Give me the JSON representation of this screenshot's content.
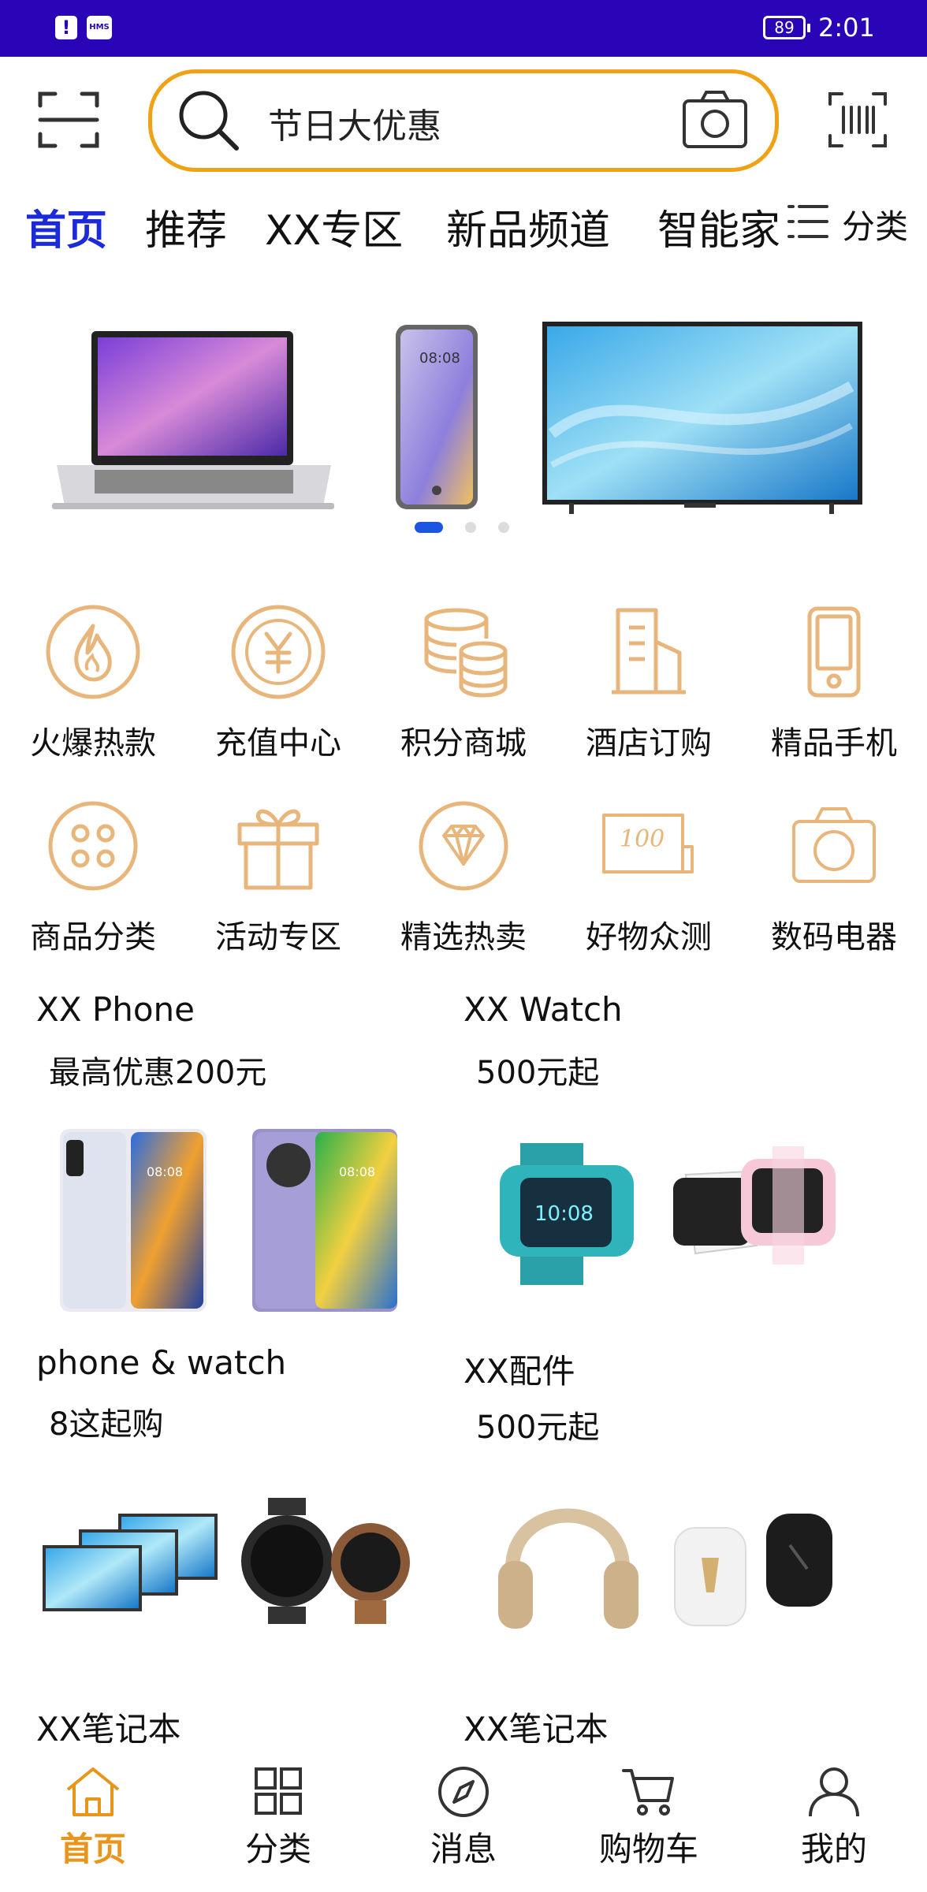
{
  "status_bar": {
    "battery": "89",
    "time": "2:01",
    "hms_label": "HMS"
  },
  "search": {
    "value": "节日大优惠"
  },
  "tabs": [
    {
      "label": "首页"
    },
    {
      "label": "推荐"
    },
    {
      "label": "XX专区"
    },
    {
      "label": "新品频道"
    },
    {
      "label": "智能家"
    }
  ],
  "category_button": {
    "label": "分类"
  },
  "banner": {
    "carousel_count": 3,
    "active_index": 0
  },
  "grid": [
    {
      "label": "火爆热款",
      "icon": "fire-icon"
    },
    {
      "label": "充值中心",
      "icon": "yen-icon"
    },
    {
      "label": "积分商城",
      "icon": "coins-icon"
    },
    {
      "label": "酒店订购",
      "icon": "hotel-icon"
    },
    {
      "label": "精品手机",
      "icon": "phone-icon"
    },
    {
      "label": "商品分类",
      "icon": "category-dots-icon"
    },
    {
      "label": "活动专区",
      "icon": "gift-icon"
    },
    {
      "label": "精选热卖",
      "icon": "diamond-icon"
    },
    {
      "label": "好物众测",
      "icon": "coupon-100-icon"
    },
    {
      "label": "数码电器",
      "icon": "camera-icon"
    }
  ],
  "products": [
    {
      "title": "XX Phone",
      "subtitle": "最高优惠200元"
    },
    {
      "title": "XX Watch",
      "subtitle": "500元起"
    },
    {
      "title": "phone & watch",
      "subtitle": "8这起购"
    },
    {
      "title": "XX配件",
      "subtitle": "500元起"
    },
    {
      "title": "XX笔记本",
      "subtitle": ""
    },
    {
      "title": "XX笔记本",
      "subtitle": ""
    }
  ],
  "bottom_nav": [
    {
      "label": "首页",
      "icon": "home-icon"
    },
    {
      "label": "分类",
      "icon": "grid-icon"
    },
    {
      "label": "消息",
      "icon": "compass-icon"
    },
    {
      "label": "购物车",
      "icon": "cart-icon"
    },
    {
      "label": "我的",
      "icon": "person-icon"
    }
  ],
  "colors": {
    "status_bar": "#2a05b8",
    "accent_orange": "#f0a214",
    "icon_orange": "#e8b57a",
    "active_tab_blue": "#1b2bd9",
    "nav_active": "#e8951c"
  }
}
